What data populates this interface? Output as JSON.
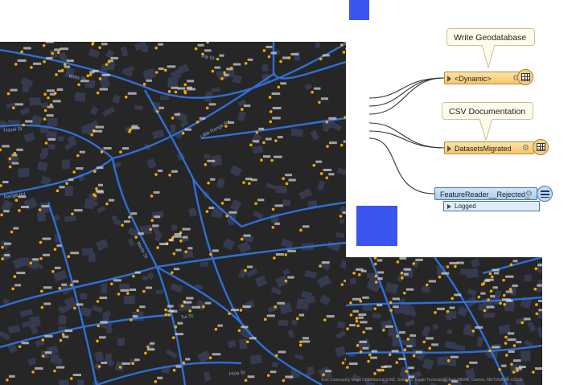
{
  "workspace": {
    "annotations": {
      "write_geodatabase": "Write Geodatabase",
      "csv_documentation": "CSV Documentation"
    },
    "writers": {
      "dynamic_port": "<Dynamic>",
      "datasets_migrated_port": "DatasetsMigrated"
    },
    "reader": {
      "name": "FeatureReader__Rejected_",
      "output_port": "Logged"
    }
  },
  "map": {
    "attribution": "Esri Community Maps Contributors, LINZ, Stats NZ, Eagle Technology, Esri, HERE, Garmin, METI/NASA, USGS",
    "street_labels": [
      "Willis St",
      "Pitt St",
      "Little Range Rd",
      "Hazel St",
      "Range Rd",
      "Merle St",
      "Tui St",
      "Huia St"
    ],
    "colors": {
      "background": "#262626",
      "roads": "#2f6fd6",
      "parcels": "#353a4e",
      "points": "#f2a900",
      "accent_squares": "#3c55f0"
    }
  }
}
